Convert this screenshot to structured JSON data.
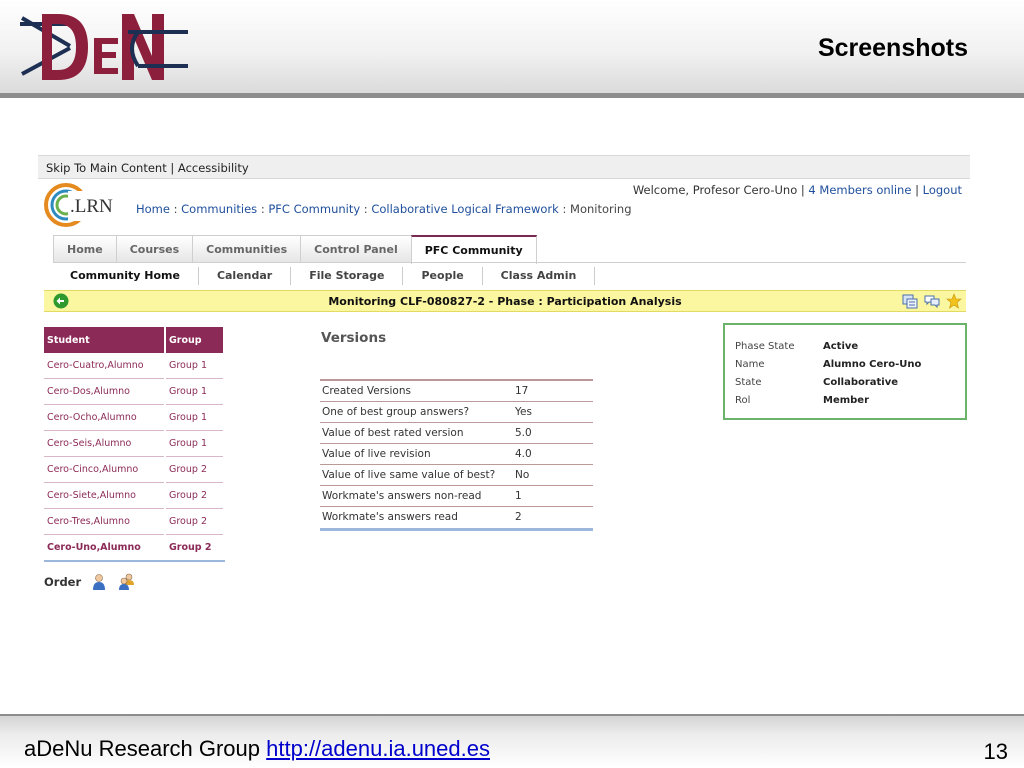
{
  "slide": {
    "title": "Screenshots",
    "footer_label": "aDeNu Research Group",
    "footer_link": "http://adenu.ia.uned.es",
    "page_number": "13"
  },
  "app": {
    "skip_links": {
      "skip": "Skip To Main Content",
      "sep": "|",
      "access": "Accessibility"
    },
    "logo_text": ".LRN",
    "breadcrumb": [
      "Home",
      "Communities",
      "PFC Community",
      "Collaborative Logical Framework",
      "Monitoring"
    ],
    "welcome": {
      "greeting": "Welcome, Profesor Cero-Uno",
      "members": "4 Members online",
      "logout": "Logout"
    },
    "tabs": [
      "Home",
      "Courses",
      "Communities",
      "Control Panel",
      "PFC Community"
    ],
    "active_tab": "PFC Community",
    "subtabs": [
      "Community Home",
      "Calendar",
      "File Storage",
      "People",
      "Class Admin"
    ],
    "status_bar": "Monitoring CLF-080827-2 - Phase : Participation Analysis",
    "students": {
      "headers": [
        "Student",
        "Group"
      ],
      "rows": [
        [
          "Cero-Cuatro,Alumno",
          "Group 1"
        ],
        [
          "Cero-Dos,Alumno",
          "Group 1"
        ],
        [
          "Cero-Ocho,Alumno",
          "Group 1"
        ],
        [
          "Cero-Seis,Alumno",
          "Group 1"
        ],
        [
          "Cero-Cinco,Alumno",
          "Group 2"
        ],
        [
          "Cero-Siete,Alumno",
          "Group 2"
        ],
        [
          "Cero-Tres,Alumno",
          "Group 2"
        ],
        [
          "Cero-Uno,Alumno",
          "Group 2"
        ]
      ],
      "order_label": "Order"
    },
    "versions": {
      "title": "Versions",
      "rows": [
        [
          "Created Versions",
          "17"
        ],
        [
          "One of best group answers?",
          "Yes"
        ],
        [
          "Value of best rated version",
          "5.0"
        ],
        [
          "Value of live revision",
          "4.0"
        ],
        [
          "Value of live same value of best?",
          "No"
        ],
        [
          "Workmate's answers non-read",
          "1"
        ],
        [
          "Workmate's answers read",
          "2"
        ]
      ]
    },
    "phase": [
      [
        "Phase State",
        "Active"
      ],
      [
        "Name",
        "Alumno Cero-Uno"
      ],
      [
        "State",
        "Collaborative"
      ],
      [
        "Rol",
        "Member"
      ]
    ]
  },
  "colors": {
    "brand": "#8c2a57",
    "link": "#1f4f9c",
    "highlight": "#fbf6a0",
    "phase_border": "#6bb36b"
  }
}
